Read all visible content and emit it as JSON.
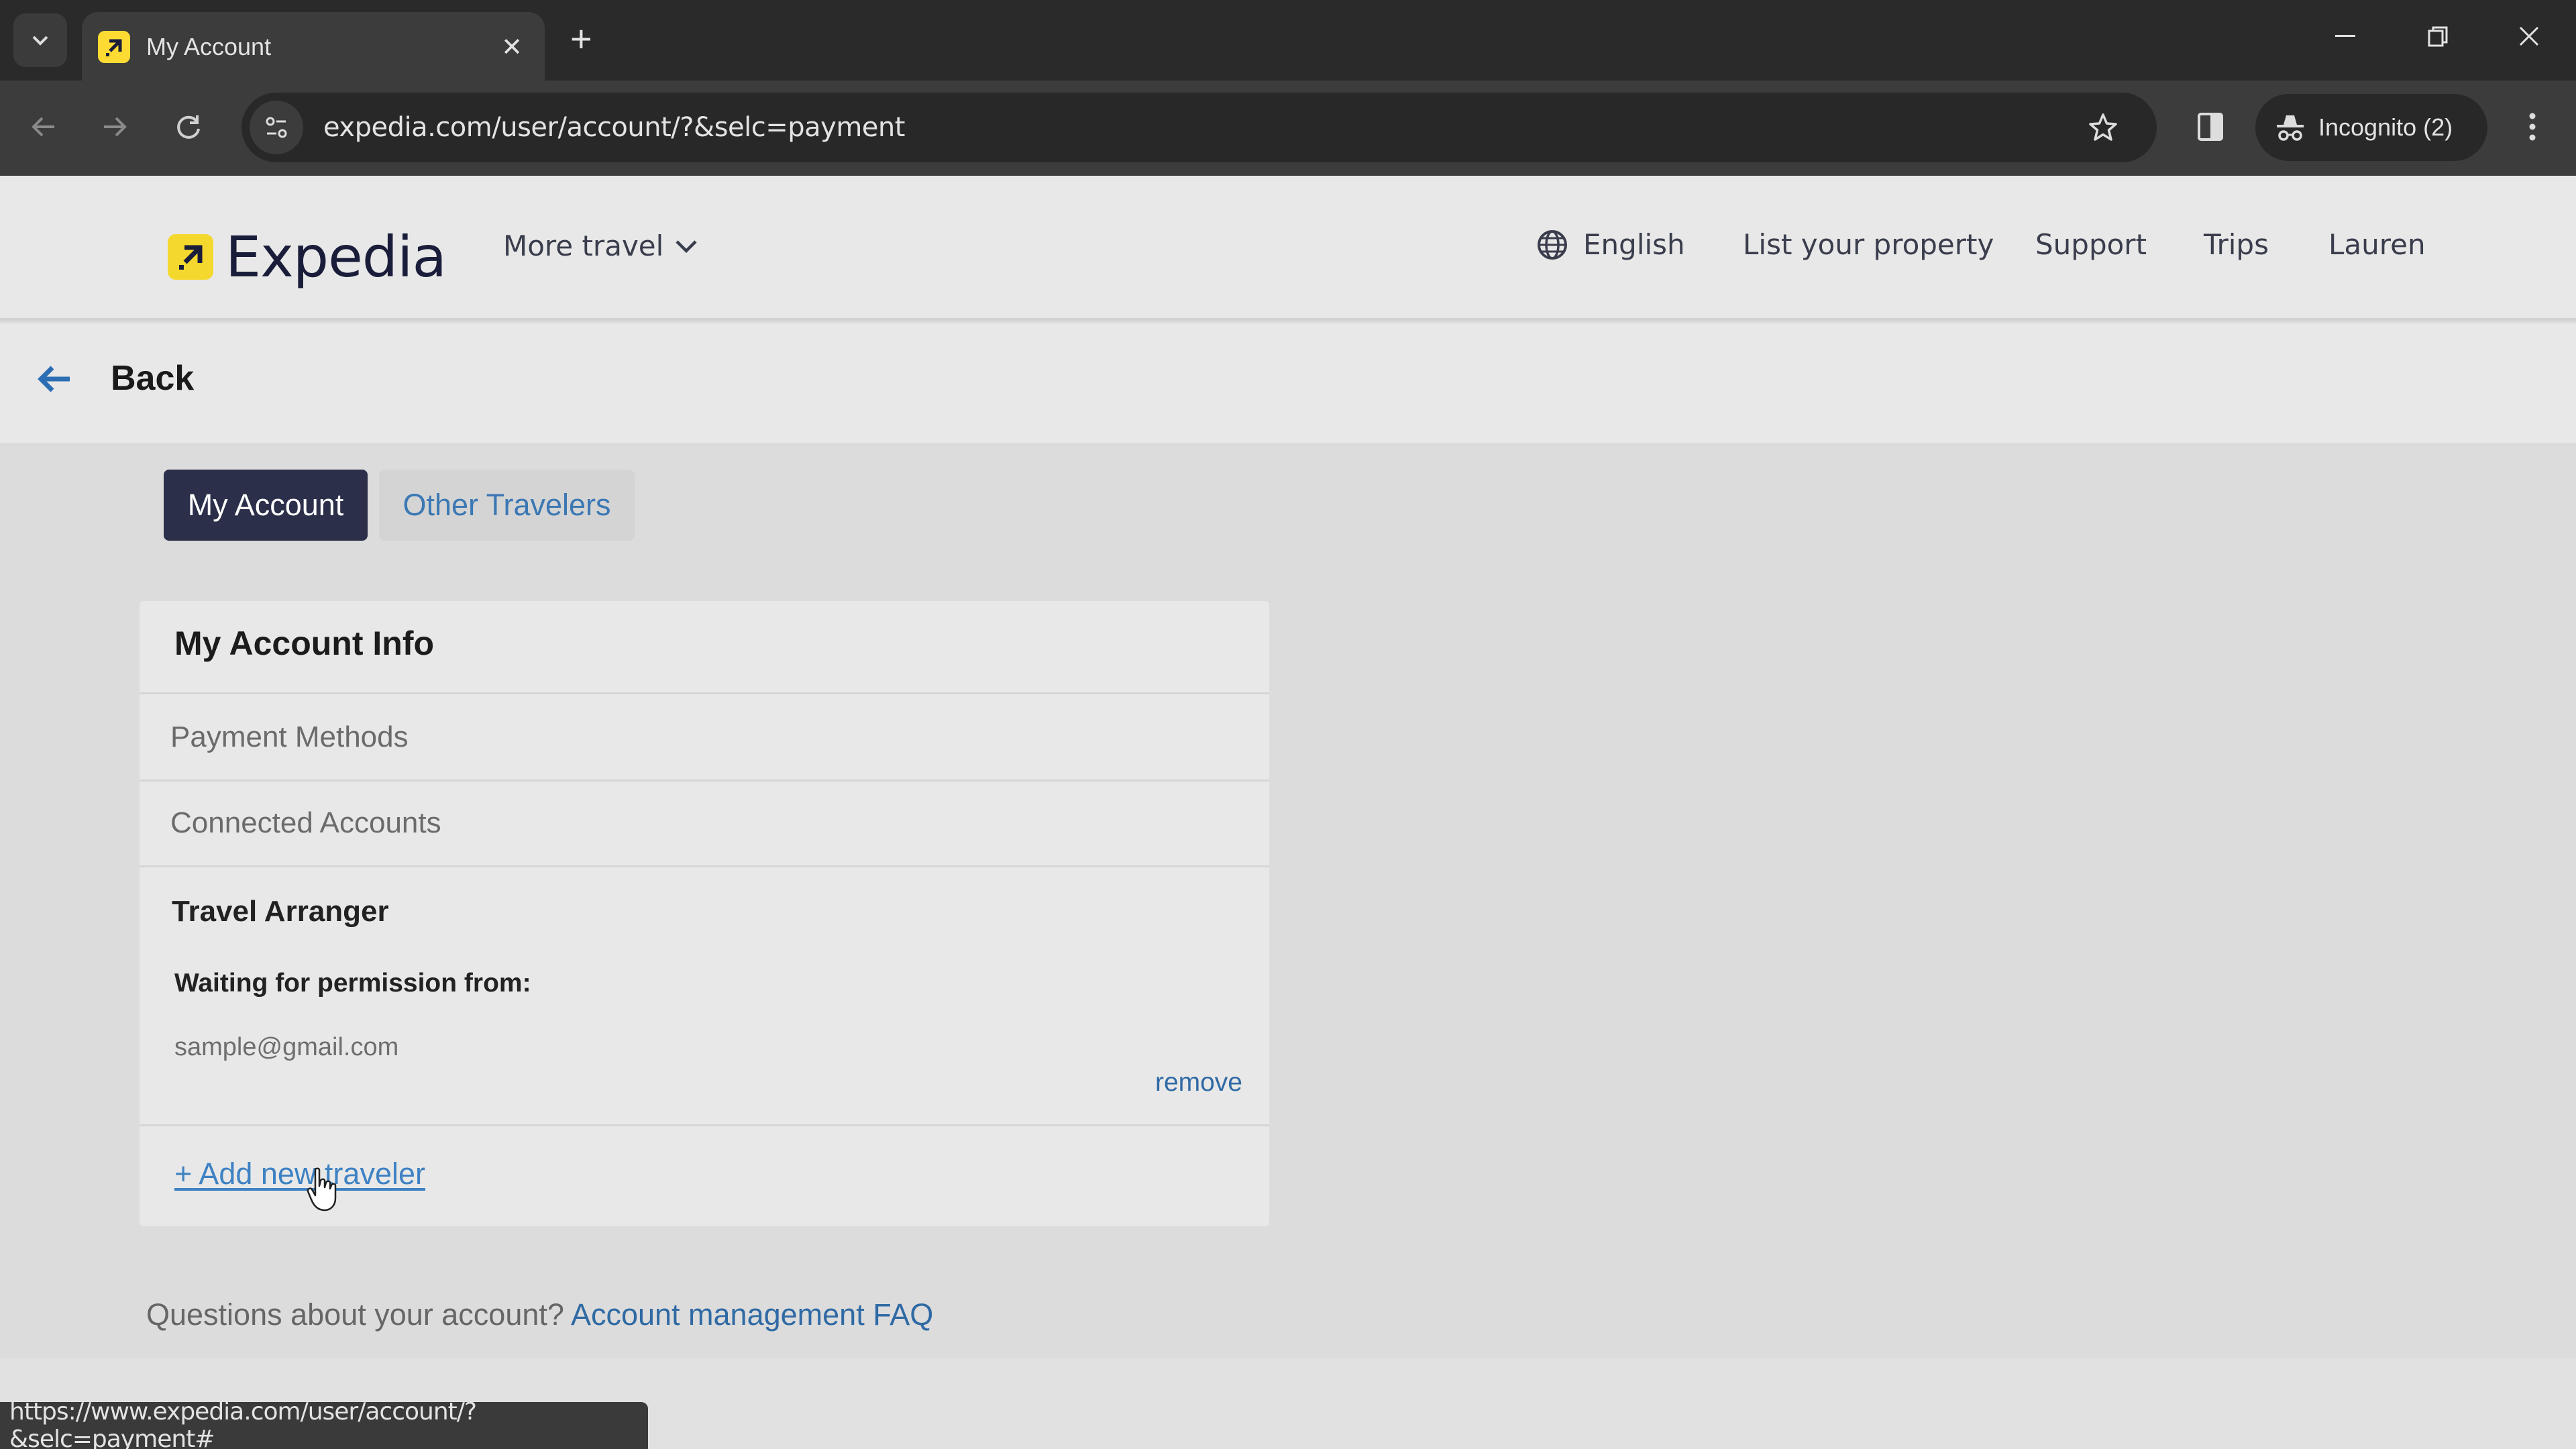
{
  "browser": {
    "tab": {
      "title": "My Account",
      "favicon": "expedia-icon"
    },
    "address_bar": {
      "url": "expedia.com/user/account/?&selc=payment"
    },
    "incognito_label": "Incognito (2)",
    "status_url": "https://www.expedia.com/user/account/?&selc=payment#"
  },
  "header": {
    "brand": "Expedia",
    "brand_color": "#f5d82e",
    "more_travel": "More travel",
    "language": "English",
    "nav": [
      "List your property",
      "Support",
      "Trips",
      "Lauren"
    ]
  },
  "back": {
    "label": "Back"
  },
  "tabs": [
    {
      "label": "My Account",
      "active": true
    },
    {
      "label": "Other Travelers",
      "active": false
    }
  ],
  "card": {
    "title": "My Account Info",
    "items": [
      "Payment Methods",
      "Connected Accounts"
    ],
    "travel_arranger": {
      "title": "Travel Arranger",
      "waiting_label": "Waiting for permission from:",
      "email": "sample@gmail.com",
      "remove_label": "remove"
    },
    "add_traveler_label": "+ Add new traveler"
  },
  "footer": {
    "question": "Questions about your account?",
    "faq_link": "Account management FAQ"
  },
  "colors": {
    "active_tab_bg": "#2b2f4a",
    "link": "#2f6aa4"
  }
}
